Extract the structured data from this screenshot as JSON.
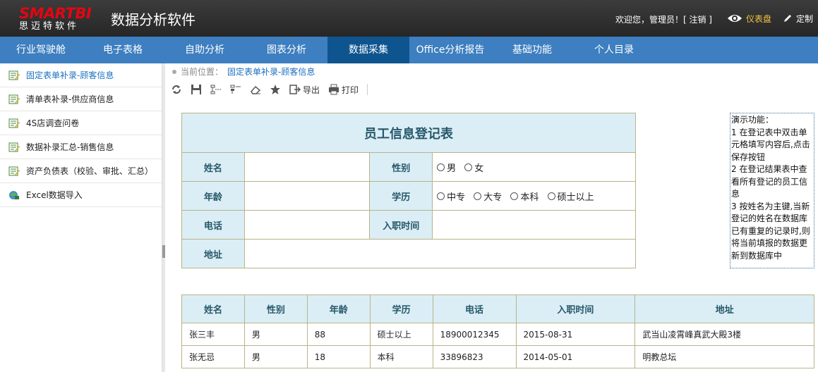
{
  "header": {
    "logo_brand": "SMARTBI",
    "logo_sub": "思迈特软件",
    "app_title": "数据分析软件",
    "welcome": "欢迎您，管理员！[ 注销 ]",
    "dashboard_label": "仪表盘",
    "custom_label": "定制"
  },
  "nav": {
    "items": [
      {
        "label": "行业驾驶舱"
      },
      {
        "label": "电子表格"
      },
      {
        "label": "自助分析"
      },
      {
        "label": "图表分析"
      },
      {
        "label": "数据采集"
      },
      {
        "label": "Office分析报告"
      },
      {
        "label": "基础功能"
      },
      {
        "label": "个人目录"
      }
    ],
    "active_index": 4
  },
  "sidebar": {
    "items": [
      {
        "label": "固定表单补录-顾客信息",
        "icon": "form-edit-icon"
      },
      {
        "label": "清单表补录-供应商信息",
        "icon": "form-edit-icon"
      },
      {
        "label": "4S店调查问卷",
        "icon": "form-edit-icon"
      },
      {
        "label": "数据补录汇总-销售信息",
        "icon": "form-edit-icon"
      },
      {
        "label": "资产负债表（校验、审批、汇总）",
        "icon": "form-edit-icon"
      },
      {
        "label": "Excel数据导入",
        "icon": "excel-import-icon"
      }
    ],
    "active_index": 0
  },
  "breadcrumb": {
    "prefix": "当前位置：",
    "path": "固定表单补录-顾客信息"
  },
  "toolbar": {
    "export_label": "导出",
    "print_label": "打印"
  },
  "form": {
    "title": "员工信息登记表",
    "name_label": "姓名",
    "gender_label": "性别",
    "gender_options": [
      "男",
      "女"
    ],
    "age_label": "年龄",
    "edu_label": "学历",
    "edu_options": [
      "中专",
      "大专",
      "本科",
      "硕士以上"
    ],
    "phone_label": "电话",
    "hire_label": "入职时间",
    "address_label": "地址"
  },
  "note": {
    "text": "演示功能：\n1 在登记表中双击单元格填写内容后,点击保存按钮\n2 在登记结果表中查看所有登记的员工信息\n3 按姓名为主键,当新登记的姓名在数据库已有重复的记录时,则将当前填报的数据更新到数据库中"
  },
  "results": {
    "headers": [
      "姓名",
      "性别",
      "年龄",
      "学历",
      "电话",
      "入职时间",
      "地址"
    ],
    "rows": [
      [
        "张三丰",
        "男",
        "88",
        "硕士以上",
        "18900012345",
        "2015-08-31",
        "武当山凌霄峰真武大殿3楼"
      ],
      [
        "张无忌",
        "男",
        "18",
        "本科",
        "33896823",
        "2014-05-01",
        "明教总坛"
      ]
    ]
  },
  "colors": {
    "nav_bg": "#3d7fc0",
    "nav_active": "#0e5590",
    "header_bg": "#2f2f2f",
    "label_bg": "#dbeef5",
    "label_text": "#27586b",
    "border": "#b9b38a",
    "brand_red": "#e30613",
    "dashboard_yellow": "#f5c342"
  }
}
